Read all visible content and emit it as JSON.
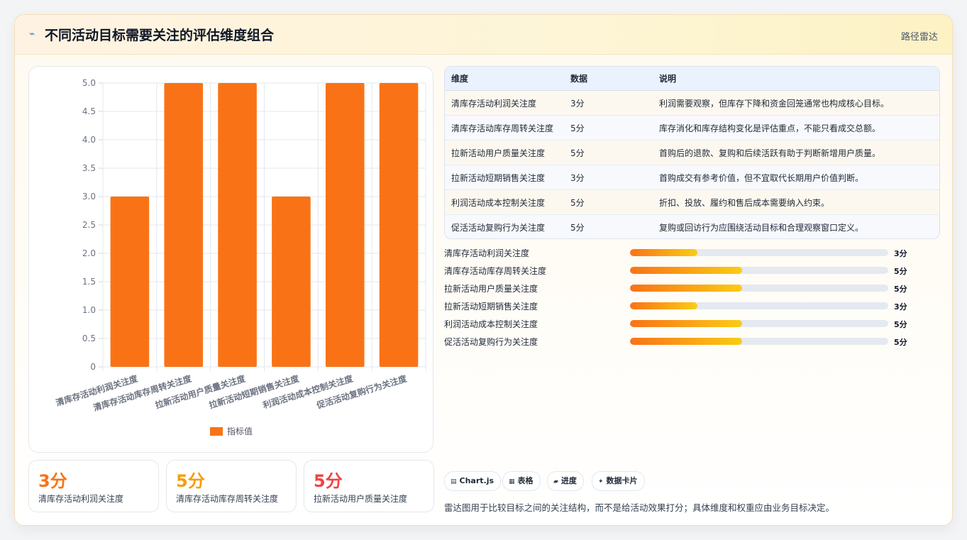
{
  "header": {
    "title": "不同活动目标需要关注的评估维度组合",
    "tag": "路径雷达",
    "icon": "bolt-icon"
  },
  "chart_data": {
    "type": "bar",
    "categories": [
      "清库存活动利润关注度",
      "清库存活动库存周转关注度",
      "拉新活动用户质量关注度",
      "拉新活动短期销售关注度",
      "利润活动成本控制关注度",
      "促活活动复购行为关注度"
    ],
    "series": [
      {
        "name": "指标值",
        "values": [
          3,
          5,
          5,
          3,
          5,
          5
        ],
        "color": "#f97316"
      }
    ],
    "ylim": [
      0,
      5
    ],
    "yticks": [
      "0",
      "0.5",
      "1.0",
      "1.5",
      "2.0",
      "2.5",
      "3.0",
      "3.5",
      "4.0",
      "4.5",
      "5.0"
    ],
    "grid": true,
    "legend": "bottom"
  },
  "stats": [
    {
      "value": "3分",
      "label": "清库存活动利润关注度",
      "color": "#f97316"
    },
    {
      "value": "5分",
      "label": "清库存活动库存周转关注度",
      "color": "#f59e0b"
    },
    {
      "value": "5分",
      "label": "拉新活动用户质量关注度",
      "color": "#ef4444"
    }
  ],
  "table": {
    "headers": [
      "维度",
      "数据",
      "说明"
    ],
    "rows": [
      [
        "清库存活动利润关注度",
        "3分",
        "利润需要观察，但库存下降和资金回笼通常也构成核心目标。"
      ],
      [
        "清库存活动库存周转关注度",
        "5分",
        "库存消化和库存结构变化是评估重点，不能只看成交总额。"
      ],
      [
        "拉新活动用户质量关注度",
        "5分",
        "首购后的退款、复购和后续活跃有助于判断新增用户质量。"
      ],
      [
        "拉新活动短期销售关注度",
        "3分",
        "首购成交有参考价值，但不宜取代长期用户价值判断。"
      ],
      [
        "利润活动成本控制关注度",
        "5分",
        "折扣、投放、履约和售后成本需要纳入约束。"
      ],
      [
        "促活活动复购行为关注度",
        "5分",
        "复购或回访行为应围绕活动目标和合理观察窗口定义。"
      ]
    ]
  },
  "progress": {
    "max": 5,
    "items": [
      {
        "label": "清库存活动利润关注度",
        "value": 3,
        "text": "3分"
      },
      {
        "label": "清库存活动库存周转关注度",
        "value": 5,
        "text": "5分"
      },
      {
        "label": "拉新活动用户质量关注度",
        "value": 5,
        "text": "5分"
      },
      {
        "label": "拉新活动短期销售关注度",
        "value": 3,
        "text": "3分"
      },
      {
        "label": "利润活动成本控制关注度",
        "value": 5,
        "text": "5分"
      },
      {
        "label": "促活活动复购行为关注度",
        "value": 5,
        "text": "5分"
      }
    ]
  },
  "chips": [
    {
      "label": "Chart.js",
      "icon": "chart-icon"
    },
    {
      "label": "表格",
      "icon": "table-icon"
    },
    {
      "label": "进度",
      "icon": "progress-icon"
    },
    {
      "label": "数据卡片",
      "icon": "sparkle-icon"
    }
  ],
  "note": "雷达图用于比较目标之间的关注结构，而不是给活动效果打分；具体维度和权重应由业务目标决定。"
}
